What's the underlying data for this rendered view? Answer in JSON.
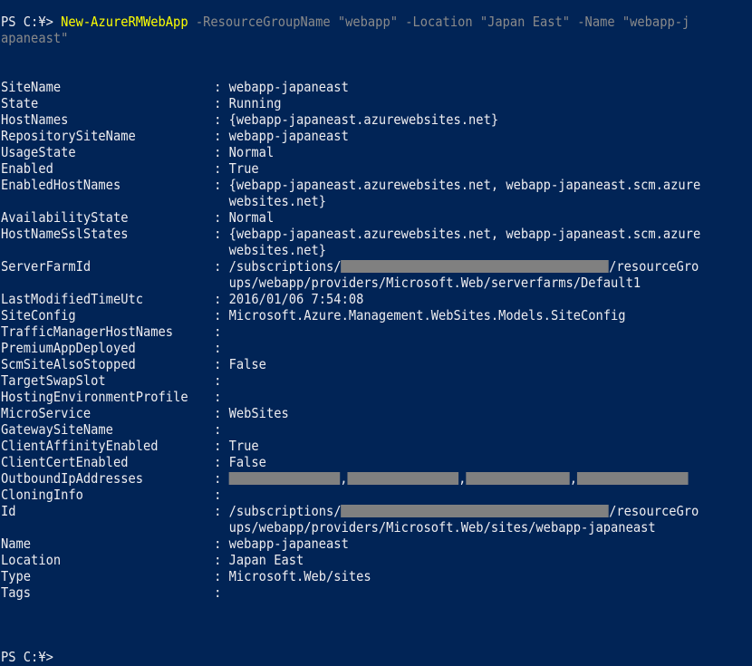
{
  "window": {
    "background_color": "#012456",
    "text_color": "#eeedf0",
    "command_color": "#ffff00",
    "parameter_value_color": "#8a8a8a",
    "redaction_color": "#808080"
  },
  "command": {
    "prompt": "PS C:¥> ",
    "cmdlet": "New-AzureRMWebApp",
    "args": [
      {
        "flag": " -ResourceGroupName ",
        "value": "\"webapp\""
      },
      {
        "flag": " -Location ",
        "value": "\"Japan East\""
      },
      {
        "flag": " -Name ",
        "value": "\"webapp-j"
      }
    ],
    "wrap_value": "apaneast\""
  },
  "properties": [
    {
      "name": "SiteName",
      "sep": ":",
      "lines": [
        "webapp-japaneast"
      ]
    },
    {
      "name": "State",
      "sep": ":",
      "lines": [
        "Running"
      ]
    },
    {
      "name": "HostNames",
      "sep": ":",
      "lines": [
        "{webapp-japaneast.azurewebsites.net}"
      ]
    },
    {
      "name": "RepositorySiteName",
      "sep": ":",
      "lines": [
        "webapp-japaneast"
      ]
    },
    {
      "name": "UsageState",
      "sep": ":",
      "lines": [
        "Normal"
      ]
    },
    {
      "name": "Enabled",
      "sep": ":",
      "lines": [
        "True"
      ]
    },
    {
      "name": "EnabledHostNames",
      "sep": ":",
      "lines": [
        "{webapp-japaneast.azurewebsites.net, webapp-japaneast.scm.azure",
        "websites.net}"
      ]
    },
    {
      "name": "AvailabilityState",
      "sep": ":",
      "lines": [
        "Normal"
      ]
    },
    {
      "name": "HostNameSslStates",
      "sep": ":",
      "lines": [
        "{webapp-japaneast.azurewebsites.net, webapp-japaneast.scm.azure",
        "websites.net}"
      ]
    },
    {
      "name": "ServerFarmId",
      "sep": ":",
      "lines": [
        "/subscriptions/",
        "ups/webapp/providers/Microsoft.Web/serverfarms/Default1"
      ],
      "redacted_suffix": "/resourceGro"
    },
    {
      "name": "LastModifiedTimeUtc",
      "sep": ":",
      "lines": [
        "2016/01/06 7:54:08"
      ]
    },
    {
      "name": "SiteConfig",
      "sep": ":",
      "lines": [
        "Microsoft.Azure.Management.WebSites.Models.SiteConfig"
      ]
    },
    {
      "name": "TrafficManagerHostNames",
      "sep": ":",
      "lines": [
        ""
      ]
    },
    {
      "name": "PremiumAppDeployed",
      "sep": ":",
      "lines": [
        ""
      ]
    },
    {
      "name": "ScmSiteAlsoStopped",
      "sep": ":",
      "lines": [
        "False"
      ]
    },
    {
      "name": "TargetSwapSlot",
      "sep": ":",
      "lines": [
        ""
      ]
    },
    {
      "name": "HostingEnvironmentProfile",
      "sep": ":",
      "lines": [
        ""
      ]
    },
    {
      "name": "MicroService",
      "sep": ":",
      "lines": [
        "WebSites"
      ]
    },
    {
      "name": "GatewaySiteName",
      "sep": ":",
      "lines": [
        ""
      ]
    },
    {
      "name": "ClientAffinityEnabled",
      "sep": ":",
      "lines": [
        "True"
      ]
    },
    {
      "name": "ClientCertEnabled",
      "sep": ":",
      "lines": [
        "False"
      ]
    },
    {
      "name": "OutboundIpAddresses",
      "sep": ":",
      "lines": [
        ""
      ],
      "ip_separators": [
        ",",
        ",",
        ","
      ]
    },
    {
      "name": "CloningInfo",
      "sep": ":",
      "lines": [
        ""
      ]
    },
    {
      "name": "Id",
      "sep": ":",
      "lines": [
        "/subscriptions/",
        "ups/webapp/providers/Microsoft.Web/sites/webapp-japaneast"
      ],
      "redacted_suffix": "/resourceGro"
    },
    {
      "name": "Name",
      "sep": ":",
      "lines": [
        "webapp-japaneast"
      ]
    },
    {
      "name": "Location",
      "sep": ":",
      "lines": [
        "Japan East"
      ]
    },
    {
      "name": "Type",
      "sep": ":",
      "lines": [
        "Microsoft.Web/sites"
      ]
    },
    {
      "name": "Tags",
      "sep": ":",
      "lines": [
        ""
      ]
    }
  ],
  "final_prompt": "PS C:¥>"
}
